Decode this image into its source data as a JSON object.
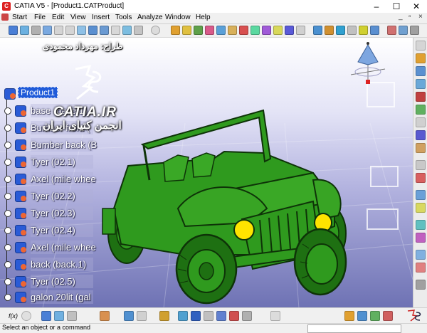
{
  "window": {
    "title": "CATIA V5 - [Product1.CATProduct]",
    "app_icon": "catia-icon"
  },
  "menu": {
    "items": [
      "Start",
      "File",
      "Edit",
      "View",
      "Insert",
      "Tools",
      "Analyze",
      "Window",
      "Help"
    ],
    "controls": [
      "_",
      "▫",
      "×"
    ]
  },
  "viewport": {
    "designer": "طراح: مهرداد محمودی",
    "logo_text": "CATIA.IR",
    "forum_text": "انجمن کتیای ایران"
  },
  "tree": {
    "root": "Product1",
    "items": [
      "base (base.1)",
      "Bumber front (",
      "Bumber back (B",
      "Tyer (02.1)",
      "Axel (mile whee",
      "Tyer (02.2)",
      "Tyer (02.3)",
      "Tyer (02.4)",
      "Axel (mile whee",
      "back (back.1)",
      "Tyer (02.5)",
      "galon 20lit (gal"
    ]
  },
  "status": {
    "message": "Select an object or a command"
  },
  "colors": {
    "viewport_top": "#ffffff",
    "viewport_bottom": "#6e72b4",
    "jeep_body": "#2f9a1e",
    "headlight": "#ffe400",
    "tree_selection": "#1f5ad9"
  }
}
